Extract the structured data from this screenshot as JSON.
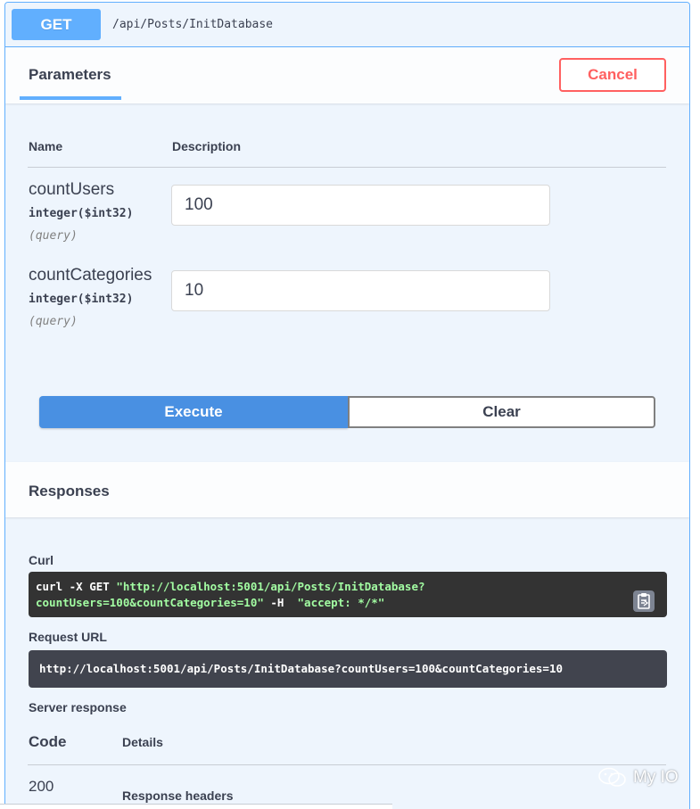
{
  "operation": {
    "method": "GET",
    "path": "/api/Posts/InitDatabase"
  },
  "parameters_section": {
    "tab_label": "Parameters",
    "cancel_label": "Cancel",
    "column_name": "Name",
    "column_description": "Description",
    "params": [
      {
        "name": "countUsers",
        "type": "integer($int32)",
        "in": "(query)",
        "value": "100"
      },
      {
        "name": "countCategories",
        "type": "integer($int32)",
        "in": "(query)",
        "value": "10"
      }
    ]
  },
  "actions": {
    "execute_label": "Execute",
    "clear_label": "Clear"
  },
  "responses_section": {
    "title": "Responses",
    "curl_label": "Curl",
    "curl_line1_cmd": "curl -X GET ",
    "curl_line1_str": "\"http://localhost:5001/api/Posts/InitDatabase?",
    "curl_line2_str": "countUsers=100&countCategories=10\"",
    "curl_line2_mid": " -H  ",
    "curl_line2_str2": "\"accept: */*\"",
    "request_url_label": "Request URL",
    "request_url": "http://localhost:5001/api/Posts/InitDatabase?countUsers=100&countCategories=10",
    "server_response_label": "Server response",
    "code_header": "Code",
    "details_header": "Details",
    "code_value": "200",
    "response_headers_label": "Response headers"
  },
  "watermark": {
    "text": "My IO",
    "icon": "wechat-icon"
  },
  "colors": {
    "get_accent": "#61affe",
    "execute": "#4990e2",
    "cancel": "#ff6060"
  }
}
